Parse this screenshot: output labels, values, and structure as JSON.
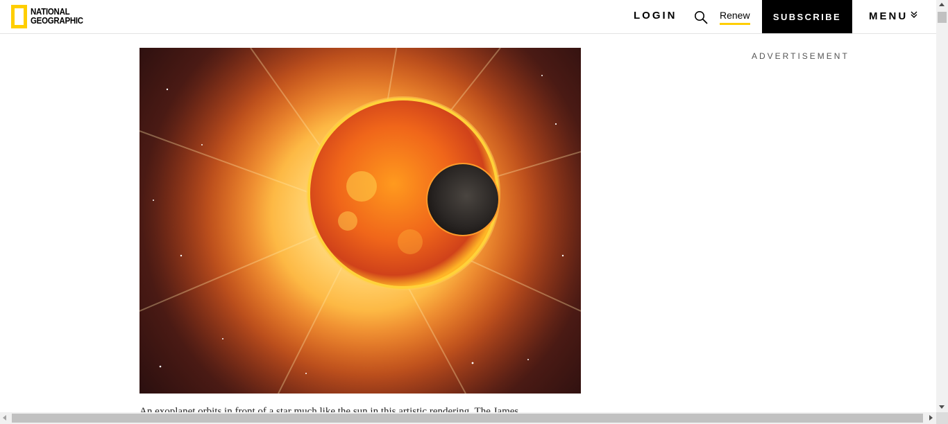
{
  "header": {
    "logo_line1": "NATIONAL",
    "logo_line2": "GEOGRAPHIC",
    "login_label": "LOGIN",
    "search_icon": "search-icon",
    "renew_label": "Renew",
    "subscribe_label": "SUBSCRIBE",
    "menu_label": "MENU",
    "menu_icon": "chevron-down-double-icon"
  },
  "article": {
    "hero_image": "star-with-exoplanet-transit-illustration",
    "caption": "An exoplanet orbits in front of a star much like the sun in this artistic rendering. The James"
  },
  "sidebar": {
    "ad_label": "ADVERTISEMENT"
  },
  "colors": {
    "brand_yellow": "#ffce00",
    "subscribe_bg": "#000000",
    "text": "#000000"
  }
}
